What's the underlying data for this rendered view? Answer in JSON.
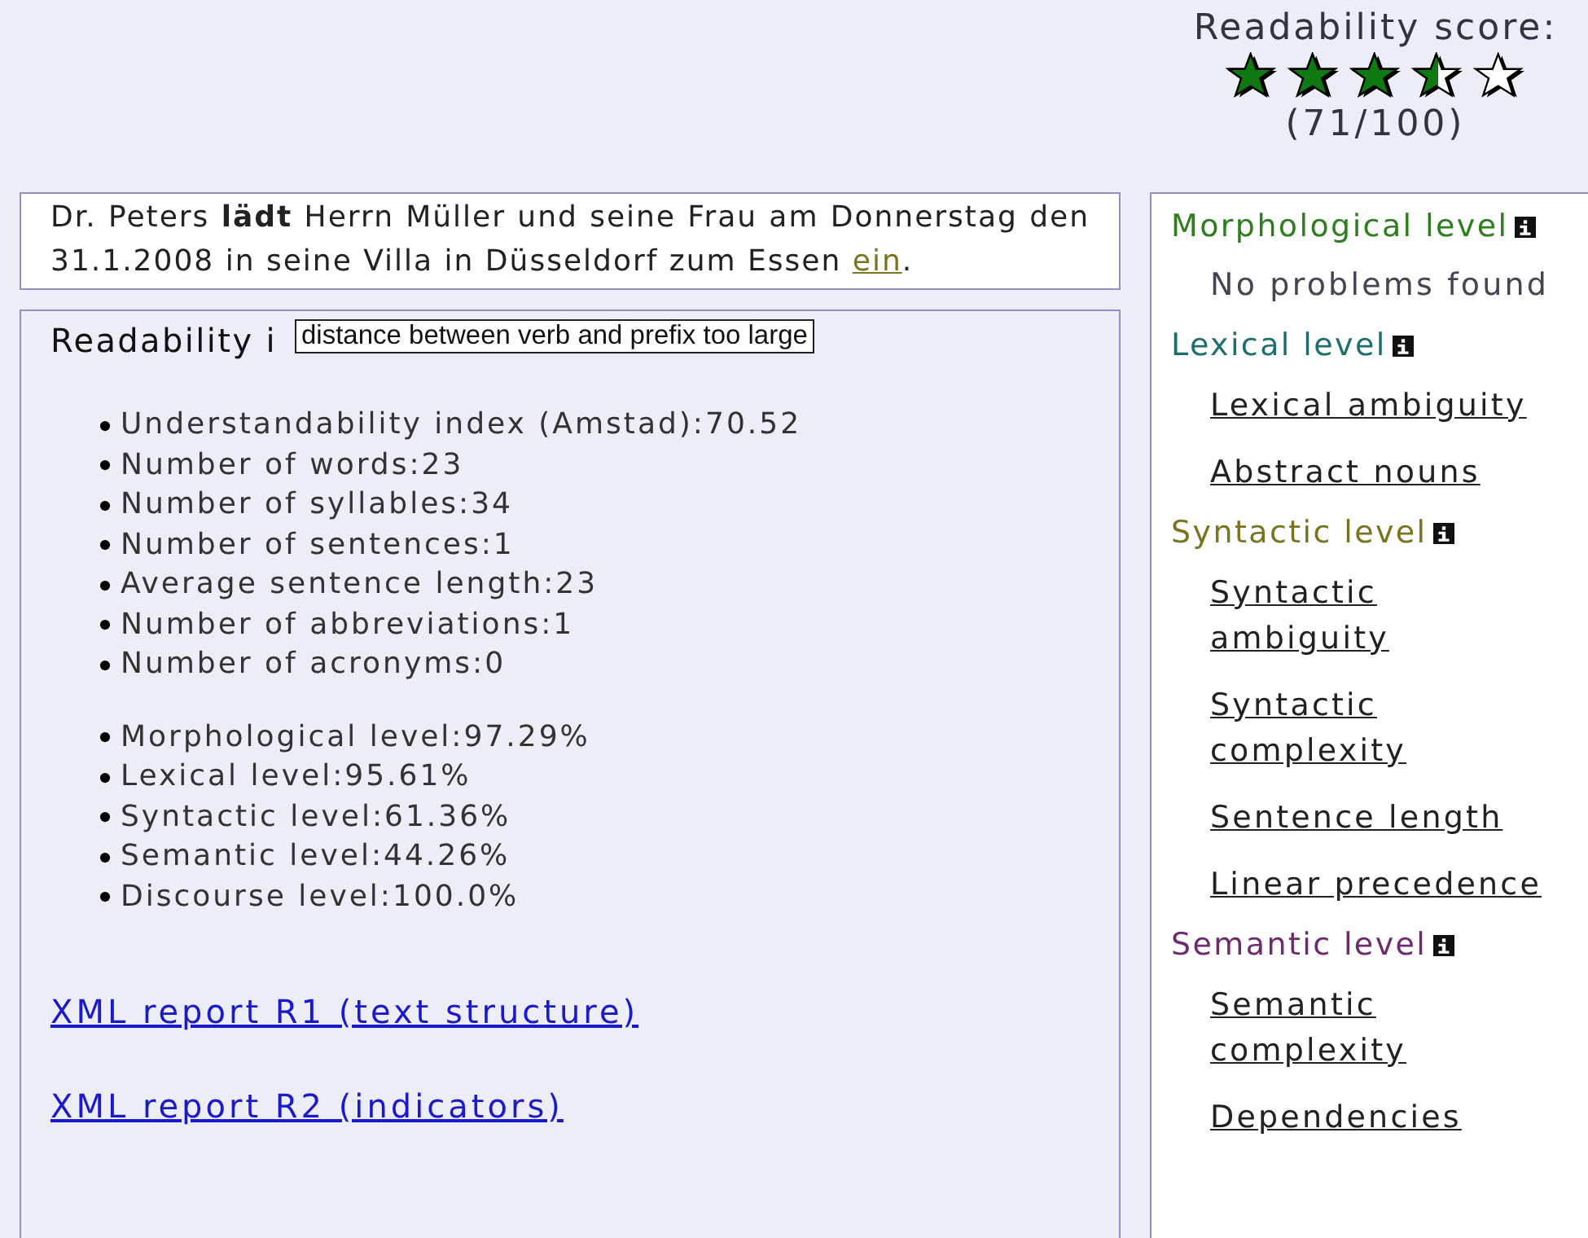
{
  "score": {
    "label": "Readability score:",
    "stars": 3.5,
    "value": "(71/100)"
  },
  "sentence": {
    "text": "Dr. Peters **lädt** Herrn Müller und seine Frau am Donnerstag den 31.1.2008 in seine Villa in Düsseldorf zum Essen ",
    "link": "ein",
    "after": "."
  },
  "report": {
    "heading": "Readability i",
    "tooltip": "distance between verb and prefix too large",
    "metrics": [
      [
        "Understandability index (Amstad):70.52",
        "Number of words:23",
        "Number of syllables:34",
        "Number of sentences:1",
        "Average sentence length:23",
        "Number of abbreviations:1",
        "Number of acronyms:0"
      ],
      [
        "Morphological level:97.29%",
        "Lexical level:95.61%",
        "Syntactic level:61.36%",
        "Semantic level:44.26%",
        "Discourse level:100.0%"
      ]
    ],
    "links": [
      "XML report R1 (text structure)",
      "XML report R2 (indicators)"
    ]
  },
  "levels": [
    {
      "title": "Morphological level",
      "color": "#2e7d1e",
      "items": [
        {
          "kind": "note",
          "label": "No problems found"
        }
      ]
    },
    {
      "title": "Lexical level",
      "color": "#1e6e6e",
      "items": [
        {
          "kind": "link",
          "label": "Lexical ambiguity"
        },
        {
          "kind": "link",
          "label": "Abstract nouns"
        }
      ]
    },
    {
      "title": "Syntactic level",
      "color": "#7a7420",
      "items": [
        {
          "kind": "link",
          "label": "Syntactic ambiguity"
        },
        {
          "kind": "link",
          "label": "Syntactic complexity"
        },
        {
          "kind": "link",
          "label": "Sentence length"
        },
        {
          "kind": "link",
          "label": "Linear precedence"
        }
      ]
    },
    {
      "title": "Semantic level",
      "color": "#6e2a6e",
      "items": [
        {
          "kind": "link",
          "label": "Semantic complexity"
        },
        {
          "kind": "link",
          "label": "Dependencies"
        }
      ]
    }
  ]
}
